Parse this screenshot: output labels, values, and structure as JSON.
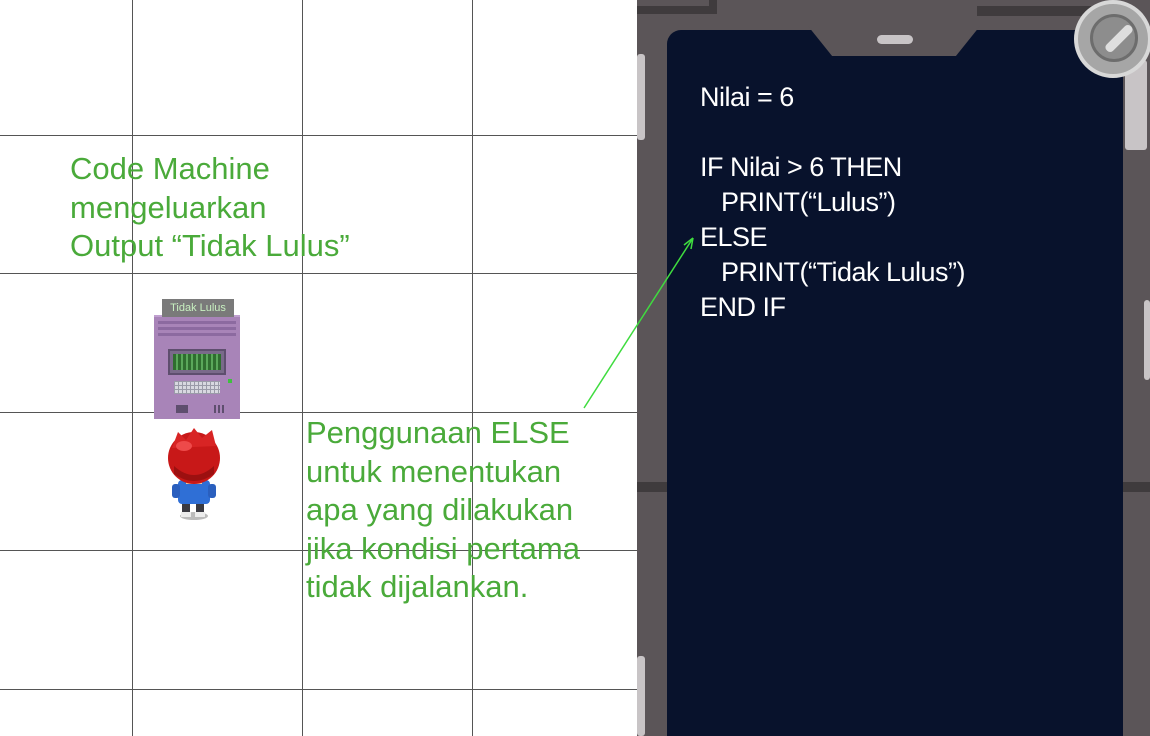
{
  "annotations": {
    "output_note": {
      "lines": [
        "Code Machine",
        "mengeluarkan",
        "Output “Tidak Lulus”"
      ]
    },
    "else_note": {
      "lines": [
        "Penggunaan ELSE",
        "untuk menentukan",
        "apa yang dilakukan",
        "jika kondisi pertama",
        "tidak dijalankan."
      ]
    }
  },
  "machine": {
    "label": "Tidak Lulus"
  },
  "code_panel": {
    "lines": [
      "Nilai = 6",
      "",
      "IF Nilai > 6 THEN",
      "   PRINT(“Lulus”)",
      "ELSE",
      "   PRINT(“Tidak Lulus”)",
      "END IF"
    ]
  },
  "colors": {
    "annotation_text": "#4aaa3a",
    "arrow": "#3fdc3f",
    "code_background": "#08122c",
    "code_text": "#ffffff",
    "frame": "#5b5558"
  },
  "icons": {
    "player": "player-character-icon",
    "machine": "code-machine-icon",
    "corner_button": "round-button-icon"
  }
}
